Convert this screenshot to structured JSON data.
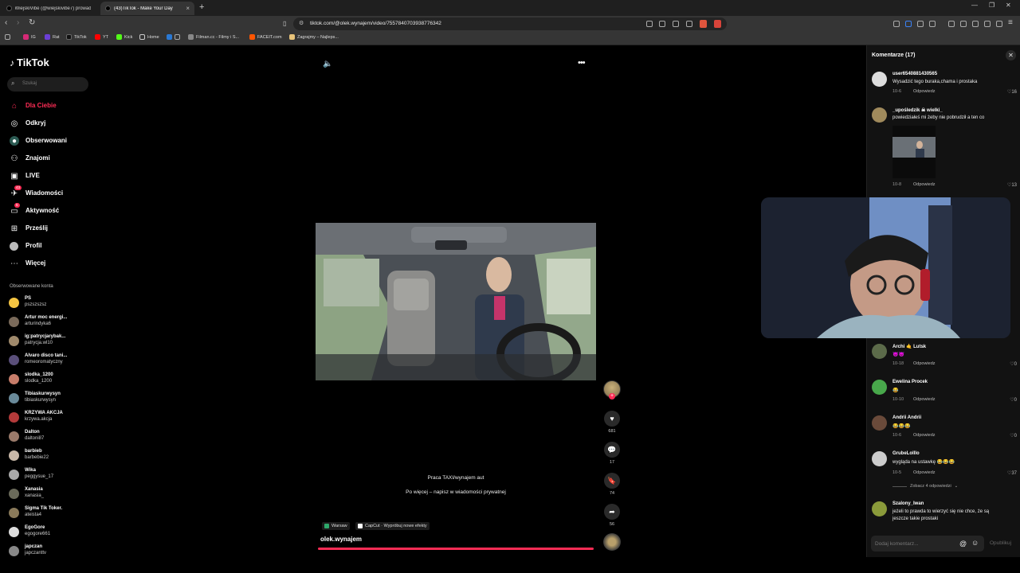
{
  "browser": {
    "tabs": [
      {
        "title": "WiejskiVibe (@wiejskivibe7) prowadzi..."
      },
      {
        "title": "(43)TikTok - Make Your Day"
      }
    ],
    "url": "tiktok.com/@olek.wynajem/video/7557840703938776342",
    "bookmarks": [
      "IG",
      "Rat",
      "TikTok",
      "YT",
      "Kick",
      "Home",
      "Filman.cc - Filmy i S...",
      "FACEIT.com",
      "Zagrajmy – Najleps..."
    ]
  },
  "sidebar": {
    "logo": "TikTok",
    "search_placeholder": "Szukaj",
    "items": [
      {
        "label": "Dla Ciebie",
        "icon": "home-icon"
      },
      {
        "label": "Odkryj",
        "icon": "compass-icon"
      },
      {
        "label": "Obserwowani",
        "icon": "following-icon"
      },
      {
        "label": "Znajomi",
        "icon": "friends-icon"
      },
      {
        "label": "LIVE",
        "icon": "live-icon"
      },
      {
        "label": "Wiadomości",
        "icon": "messages-icon",
        "badge": "43"
      },
      {
        "label": "Aktywność",
        "icon": "activity-icon",
        "badge": "5"
      },
      {
        "label": "Prześlij",
        "icon": "upload-icon"
      },
      {
        "label": "Profil",
        "icon": "profile-icon"
      },
      {
        "label": "Więcej",
        "icon": "more-icon"
      }
    ],
    "followed_title": "Obserwowane konta",
    "accounts": [
      {
        "name": "PS",
        "user": "pszszszsz"
      },
      {
        "name": "Artur moc energi...",
        "user": "arturindyka6"
      },
      {
        "name": "ig:patrycjarybak...",
        "user": "patrycja.wl10"
      },
      {
        "name": "Alvaro disco tani...",
        "user": "romeoromatyczny"
      },
      {
        "name": "slodka_1200",
        "user": "slodka_1200"
      },
      {
        "name": "Tibiaskurwysyn",
        "user": "tibiaskurwysyn"
      },
      {
        "name": "KRZYWA AKCJA",
        "user": "krzywa.akcja"
      },
      {
        "name": "Dalton",
        "user": "daltoni87"
      },
      {
        "name": "barbieb",
        "user": "barbebie22"
      },
      {
        "name": "Wika",
        "user": "peggysue_17"
      },
      {
        "name": "Xanasia",
        "user": "xanasia_"
      },
      {
        "name": "Sigma Tik Toker.",
        "user": "ateista4"
      },
      {
        "name": "EgoGore",
        "user": "egogore661"
      },
      {
        "name": "japczan",
        "user": "japczanttv"
      }
    ]
  },
  "video": {
    "caption_line1": "Praca TAXI/wynajem aut",
    "caption_line2": "Po więcej – napisz w wiadomości prywatnej",
    "chips": [
      "Warsaw",
      "CapCut · Wypróbuj nowe efekty"
    ],
    "author": "olek.wynajem",
    "progress": 1.0,
    "actions": [
      {
        "icon": "heart-icon",
        "count": "681"
      },
      {
        "icon": "comment-icon",
        "count": "17"
      },
      {
        "icon": "bookmark-icon",
        "count": "74"
      },
      {
        "icon": "share-icon",
        "count": "56"
      }
    ]
  },
  "comments": {
    "title": "Komentarze (17)",
    "input_placeholder": "Dodaj komentarz...",
    "post_label": "Opublikuj",
    "reply_label": "Odpowiedz",
    "view_replies": "Zobacz 4 odpowiedzi",
    "items": [
      {
        "user": "user6540881430565",
        "text": "Wysadzić tego buraka,chama i prostaka",
        "date": "10-6",
        "likes": "16"
      },
      {
        "user": "_upośledzik ☠ wielki_",
        "text": "powiedziałeś mi żeby nie pobrudził a ten co",
        "date": "10-8",
        "likes": "13"
      },
      {
        "user": "Archi 🤙 Lutsk",
        "text": "😈😈",
        "date": "10-18",
        "likes": "0"
      },
      {
        "user": "Ewelina Procek",
        "text": "😂",
        "date": "10-10",
        "likes": "0"
      },
      {
        "user": "Andrii Andrii",
        "text": "😂😂😂",
        "date": "10-6",
        "likes": "0"
      },
      {
        "user": "GrubeLolllo",
        "text": "wygląda na ustawkę 😂😂😂",
        "date": "10-5",
        "likes": "37"
      },
      {
        "user": "Szalony_Iwan",
        "text": "jeżeli to prawda to wierzyć się nie chce, że są",
        "text2": "jeszcze takie prostaki",
        "date": "",
        "likes": ""
      }
    ]
  },
  "colors": {
    "accent": "#fe2c55",
    "panel_bg": "#121212",
    "chrome_bg": "#353535"
  }
}
